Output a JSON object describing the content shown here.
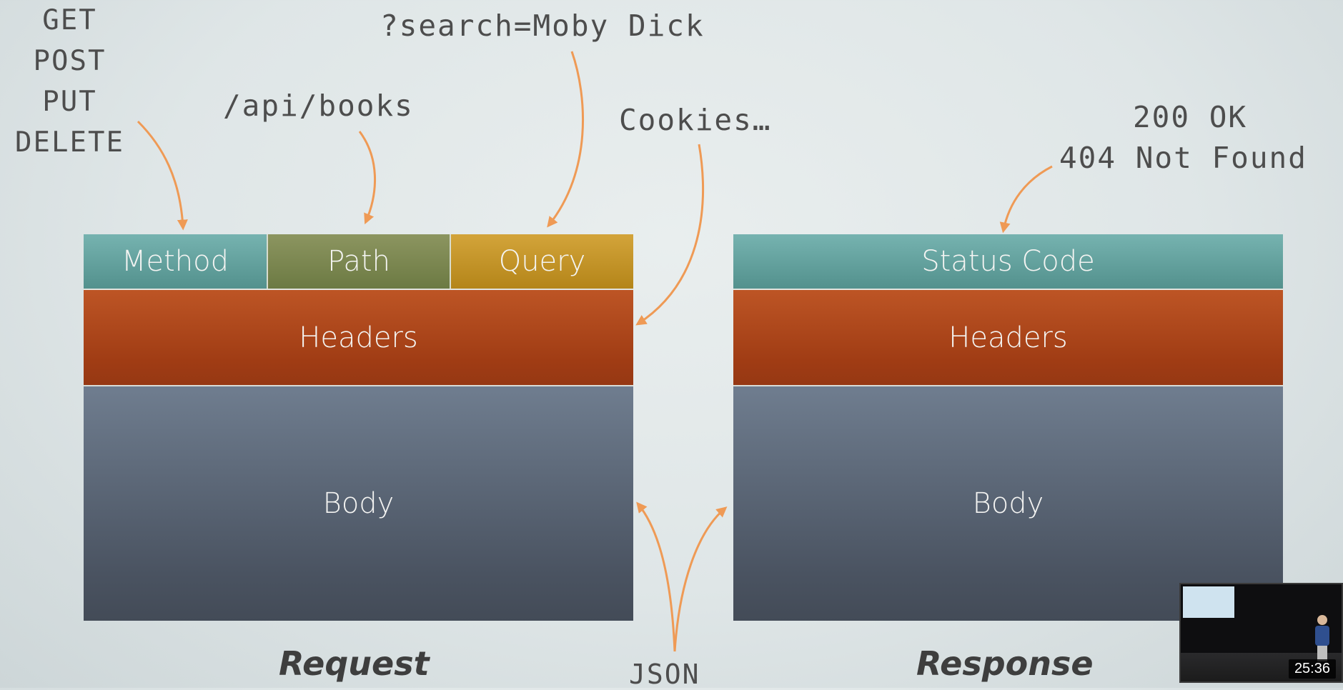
{
  "methods": [
    "GET",
    "POST",
    "PUT",
    "DELETE"
  ],
  "annotations": {
    "path_example": "/api/books",
    "query_example": "?search=Moby Dick",
    "cookies": "Cookies…",
    "status_ok": "200 OK",
    "status_not_found": "404 Not Found",
    "json": "JSON"
  },
  "request": {
    "method": "Method",
    "path": "Path",
    "query": "Query",
    "headers": "Headers",
    "body": "Body",
    "caption": "Request"
  },
  "response": {
    "status_code": "Status Code",
    "headers": "Headers",
    "body": "Body",
    "caption": "Response"
  },
  "video": {
    "timestamp": "25:36"
  },
  "colors": {
    "arrow": "#ef9a55",
    "teal": "#5f9f9b",
    "olive": "#7b8650",
    "gold": "#c4952a",
    "orange": "#ad4719",
    "slate": "#5a6575"
  }
}
